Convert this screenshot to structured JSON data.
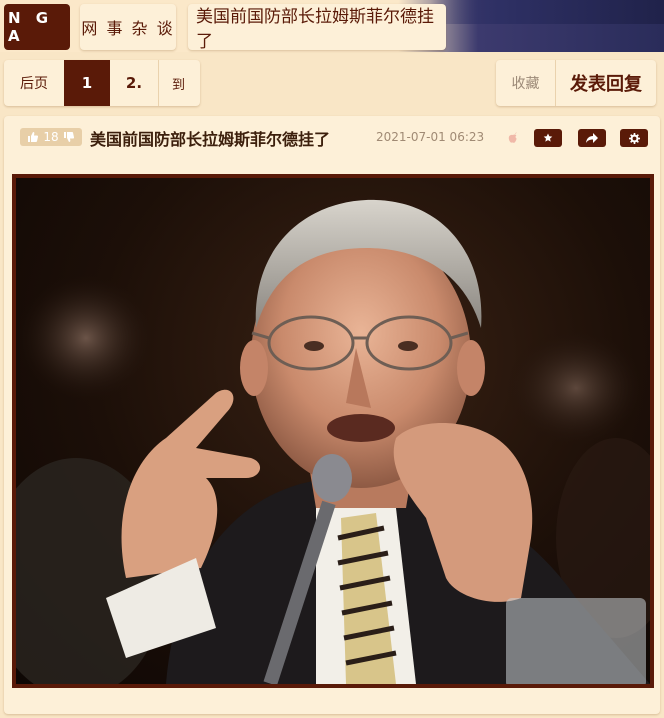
{
  "header": {
    "logo": "N G A",
    "forum": "网 事 杂 谈",
    "thread": "美国前国防部长拉姆斯菲尔德挂了"
  },
  "pager": {
    "prev": "后页",
    "current": "1",
    "next": "2.",
    "goto": "到"
  },
  "actions": {
    "favorite": "收藏",
    "reply": "发表回复"
  },
  "post": {
    "votes": "18",
    "title": "美国前国防部长拉姆斯菲尔德挂了",
    "time": "2021-07-01 06:23",
    "icons": [
      "thumbs-up-icon",
      "thumbs-down-icon",
      "apple-icon",
      "star-icon",
      "share-icon",
      "gear-icon"
    ],
    "image": "photo of an elderly man in glasses and a dark suit with striped tie, gesturing while speaking into a microphone at a hearing"
  },
  "colors": {
    "brand": "#5a1a08",
    "background": "#f9e6c6",
    "panel": "#fdf0d8"
  }
}
